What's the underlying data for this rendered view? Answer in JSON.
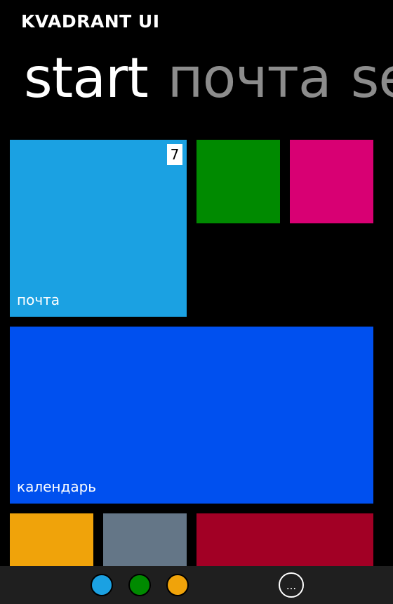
{
  "app": {
    "title": "KVADRANT UI"
  },
  "pivot": {
    "items": [
      {
        "label": "start",
        "active": true
      },
      {
        "label": "почта",
        "active": false
      },
      {
        "label": "settings",
        "active": false
      }
    ]
  },
  "tiles": {
    "mail": {
      "label": "почта",
      "badge": "7",
      "color": "#1ba1e2"
    },
    "green": {
      "color": "#008a00"
    },
    "magenta": {
      "color": "#d80073"
    },
    "calendar": {
      "label": "календарь",
      "color": "#0050ef"
    },
    "amber": {
      "color": "#f0a30a"
    },
    "steel": {
      "color": "#647687"
    },
    "crimson": {
      "color": "#a20025"
    }
  },
  "appbar": {
    "buttons": [
      {
        "name": "cyan",
        "color": "#1ba1e2"
      },
      {
        "name": "green",
        "color": "#008a00"
      },
      {
        "name": "amber",
        "color": "#f0a30a"
      }
    ],
    "more": {
      "icon": "more-icon",
      "glyph": "..."
    }
  }
}
